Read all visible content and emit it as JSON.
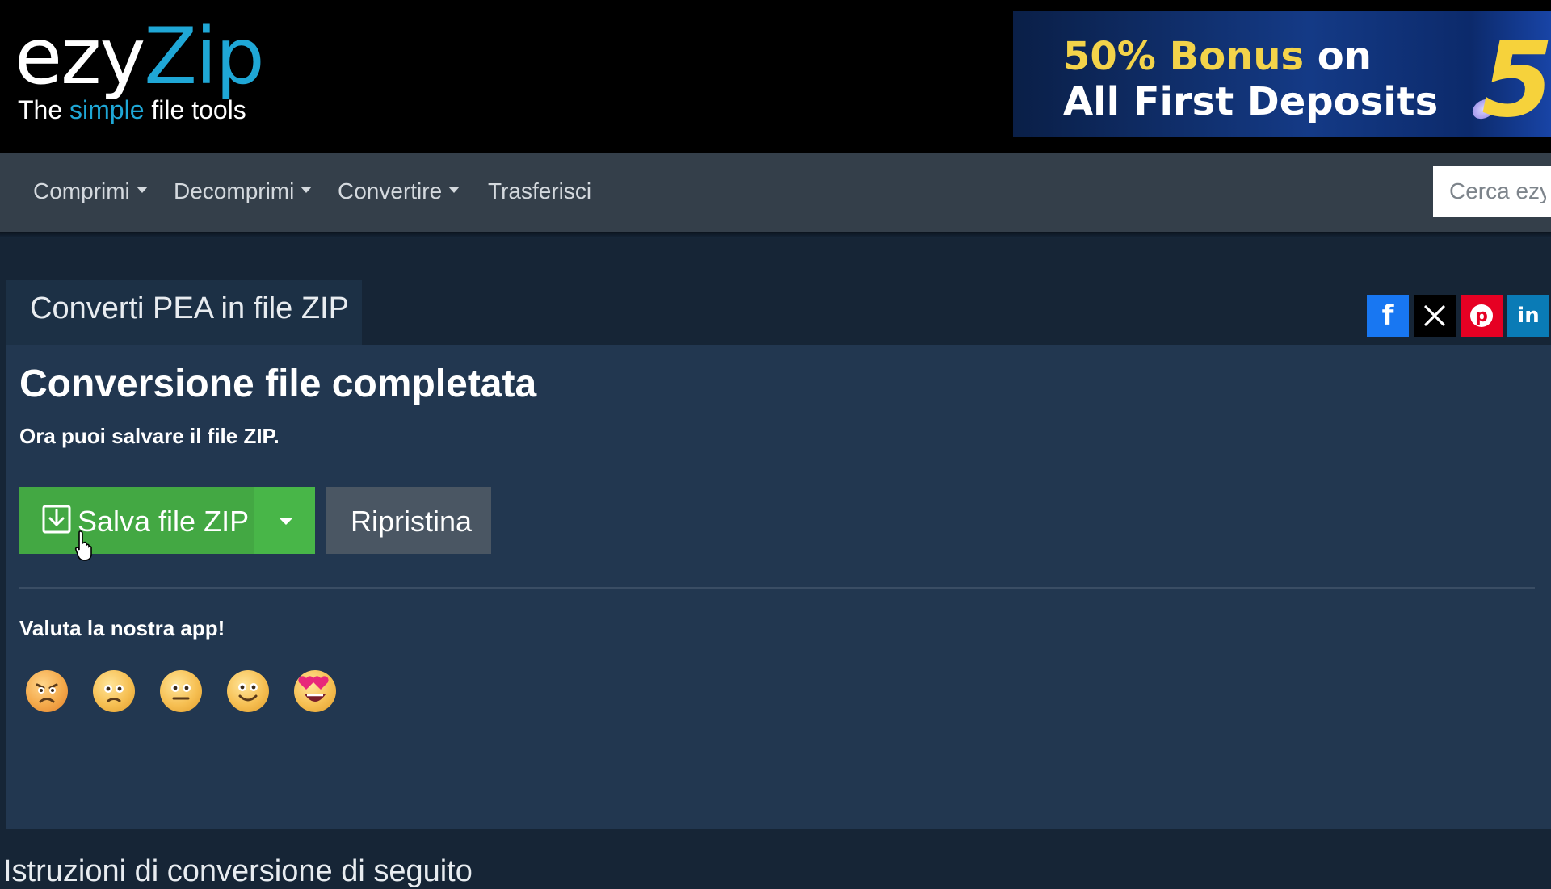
{
  "header": {
    "logo": {
      "word_part1": "ezy",
      "word_part2": "Zip",
      "tagline_before": "The ",
      "tagline_highlight": "simple",
      "tagline_after": " file tools"
    },
    "ad": {
      "line1_highlight": "50% Bonus",
      "line1_rest": " on",
      "line2": "All First Deposits",
      "badge": "5"
    }
  },
  "nav": {
    "items": [
      {
        "label": "Comprimi",
        "dropdown": true
      },
      {
        "label": "Decomprimi",
        "dropdown": true
      },
      {
        "label": "Convertire",
        "dropdown": true
      },
      {
        "label": "Trasferisci",
        "dropdown": false
      }
    ],
    "search_placeholder": "Cerca ezyZip"
  },
  "tab_title": "Converti PEA in file ZIP",
  "share": [
    {
      "name": "facebook",
      "icon": "facebook-icon",
      "color": "#1877f2"
    },
    {
      "name": "x",
      "icon": "x-icon",
      "color": "#000000"
    },
    {
      "name": "pinterest",
      "icon": "pinterest-icon",
      "color": "#e60023"
    },
    {
      "name": "linkedin",
      "icon": "linkedin-icon",
      "color": "#0a7bb6"
    }
  ],
  "main": {
    "heading": "Conversione file completata",
    "subtext": "Ora puoi salvare il file ZIP.",
    "save_button": "Salva file ZIP",
    "reset_button": "Ripristina",
    "rate_label": "Valuta la nostra app!",
    "ratings": [
      "angry-face-icon",
      "frowning-face-icon",
      "neutral-face-icon",
      "smiling-face-icon",
      "heart-eyes-face-icon"
    ]
  },
  "footer_heading": "Istruzioni di conversione di seguito",
  "colors": {
    "accent": "#1fa7d6",
    "save_green": "#43a843",
    "card_bg": "#223750",
    "page_bg": "#162536"
  }
}
